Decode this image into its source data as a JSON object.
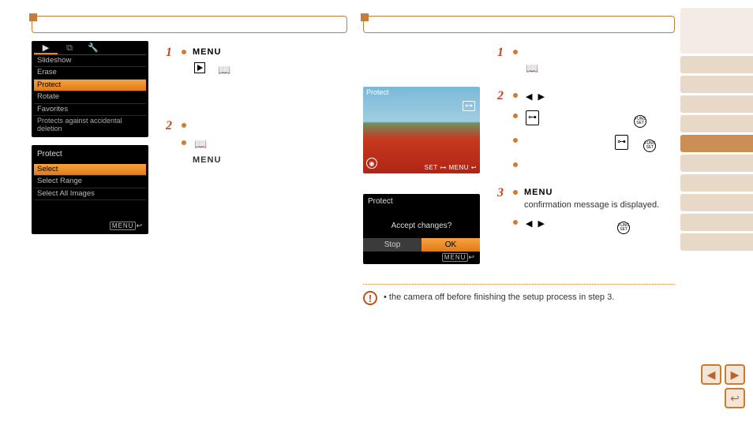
{
  "left": {
    "header_title": "",
    "lcd1": {
      "tabs": [
        "▶",
        "⧉",
        "🔧"
      ],
      "items": [
        "Slideshow",
        "Erase",
        "Protect",
        "Rotate",
        "Favorites"
      ],
      "selected": "Protect",
      "hint": "Protects against accidental deletion"
    },
    "lcd2": {
      "title": "Protect",
      "items": [
        "Select",
        "Select Range",
        "Select All Images"
      ],
      "selected": "Select",
      "footer_menu": "MENU",
      "footer_back": "↩"
    },
    "steps": {
      "s1_num": "1",
      "s1_menu": "MENU",
      "s2_num": "2",
      "s2_menu": "MENU"
    }
  },
  "right": {
    "header_title": "",
    "photo": {
      "title": "Protect",
      "bottom": "SET ⊶  MENU ↩",
      "lock": "⊶"
    },
    "lcd_confirm": {
      "title": "Protect",
      "msg": "Accept changes?",
      "btn_stop": "Stop",
      "btn_ok": "OK",
      "footer_menu": "MENU",
      "footer_back": "↩"
    },
    "steps": {
      "s1_num": "1",
      "s2_num": "2",
      "s3_num": "3",
      "s3_menu": "MENU",
      "s3_text": "confirmation message is displayed."
    }
  },
  "note": {
    "text": "the camera off before finishing the setup process in step 3."
  },
  "icons": {
    "book": "📖",
    "lock": "⊶",
    "funcset": "FUNC SET"
  }
}
